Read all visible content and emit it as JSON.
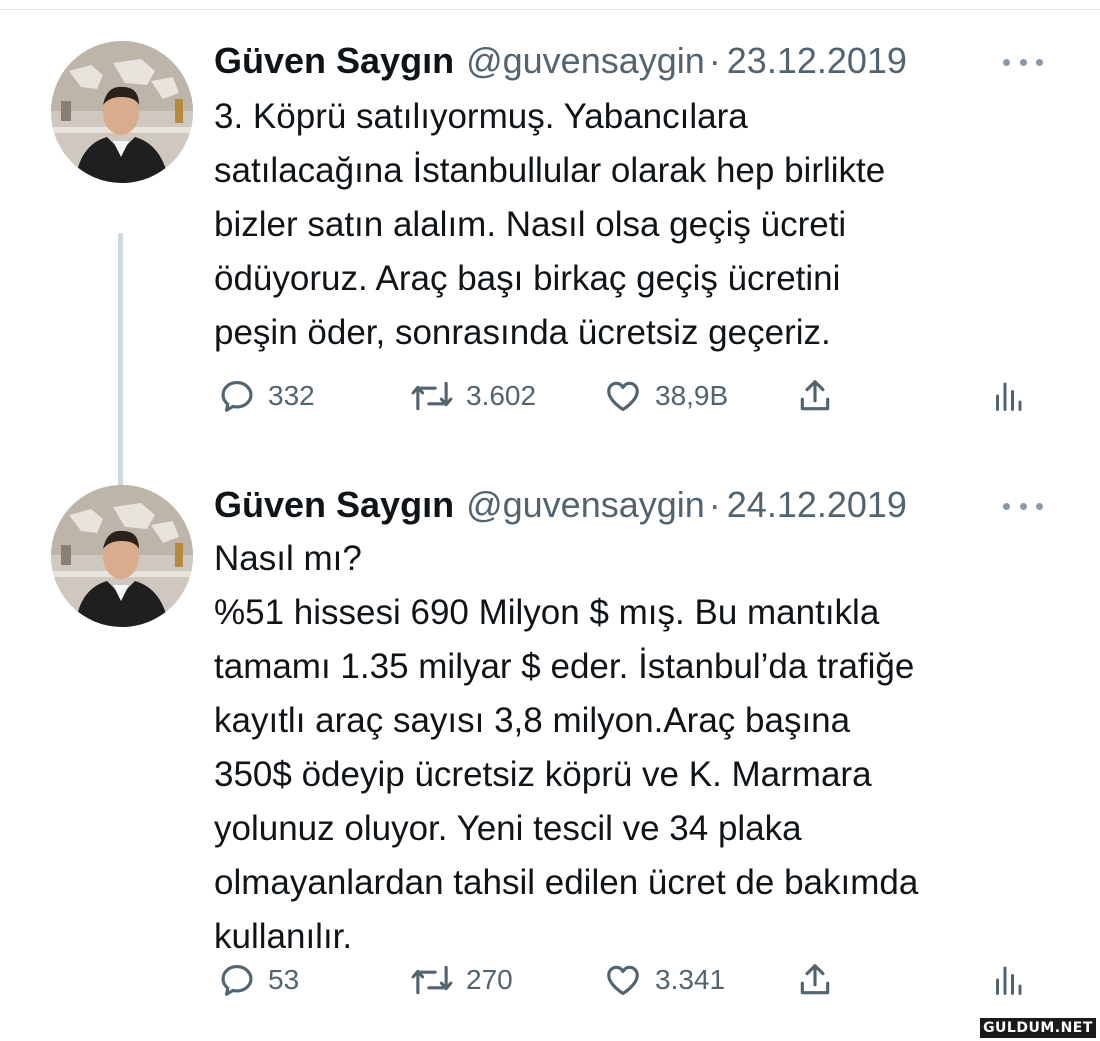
{
  "watermark": "GULDUM.NET",
  "tweets": [
    {
      "name": "Güven Saygın",
      "handle": "@guvensaygin",
      "separator": "·",
      "date": "23.12.2019",
      "lines": [
        "3. Köprü satılıyormuş. Yabancılara",
        "satılacağına İstanbullular olarak hep birlikte",
        "bizler satın alalım. Nasıl olsa geçiş ücreti",
        "ödüyoruz. Araç başı birkaç geçiş ücretini",
        "peşin öder, sonrasında ücretsiz geçeriz."
      ],
      "replies": "332",
      "retweets": "3.602",
      "likes": "38,9B"
    },
    {
      "name": "Güven Saygın",
      "handle": "@guvensaygin",
      "separator": "·",
      "date": "24.12.2019",
      "lines": [
        "Nasıl mı?",
        "%51 hissesi 690 Milyon $ mış. Bu mantıkla",
        "tamamı 1.35 milyar $ eder. İstanbul’da trafiğe",
        "kayıtlı araç sayısı 3,8 milyon.Araç başına",
        "350$ ödeyip ücretsiz köprü ve K. Marmara",
        "yolunuz oluyor. Yeni tescil ve 34 plaka",
        "olmayanlardan tahsil edilen ücret de bakımda",
        "kullanılır."
      ],
      "replies": "53",
      "retweets": "270",
      "likes": "3.341"
    }
  ],
  "icons": {
    "reply": "reply-icon",
    "retweet": "retweet-icon",
    "like": "like-icon",
    "share": "share-icon",
    "analytics": "analytics-icon",
    "more": "more-icon"
  },
  "colors": {
    "text": "#0f1419",
    "secondary": "#536471",
    "thread_line": "#cfd9de"
  }
}
